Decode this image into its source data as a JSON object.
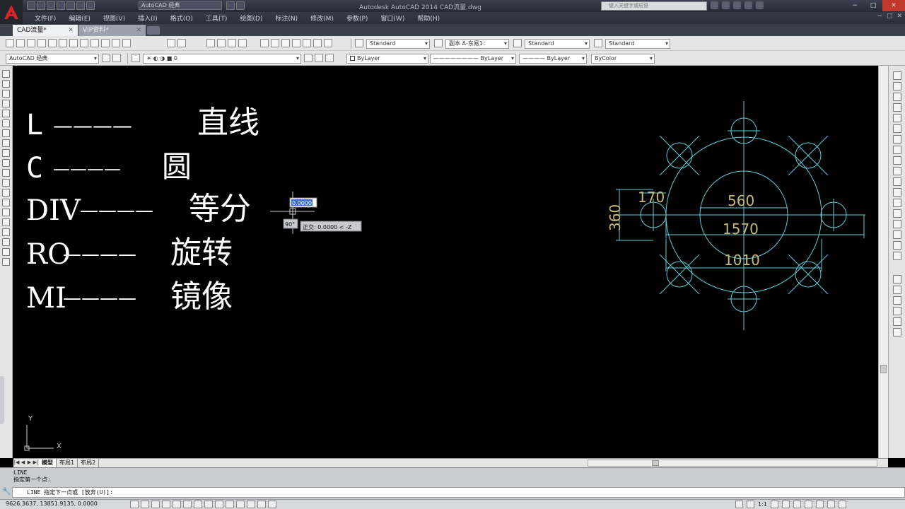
{
  "window": {
    "title": "Autodesk AutoCAD 2014    CAD流量.dwg",
    "workspace": "AutoCAD 经典",
    "search_placeholder": "键入关键字或短语",
    "controls": [
      "−",
      "□",
      "✕"
    ]
  },
  "menus": [
    "文件(F)",
    "编辑(E)",
    "视图(V)",
    "插入(I)",
    "格式(O)",
    "工具(T)",
    "绘图(D)",
    "标注(N)",
    "修改(M)",
    "参数(P)",
    "窗口(W)",
    "帮助(H)"
  ],
  "mdi_controls": [
    "−",
    "□",
    "✕"
  ],
  "tabs": [
    {
      "label": "CAD流量*",
      "close": "✕"
    },
    {
      "label": "VIP资料*",
      "close": "✕"
    }
  ],
  "styles_toolbar": {
    "text_style": "Standard",
    "dim_style": "副本 A-东易1：",
    "table_style": "Standard",
    "mleader_style": "Standard"
  },
  "layers_toolbar": {
    "workspace": "AutoCAD 经典",
    "layer": "0",
    "color": "ByLayer",
    "linetype": "ByLayer",
    "lineweight": "ByLayer",
    "plotstyle": "ByColor"
  },
  "drawing": {
    "notes": [
      {
        "cmd": "L",
        "dash": "————",
        "meaning": "直线"
      },
      {
        "cmd": "C",
        "dash": "————",
        "meaning": "圆"
      },
      {
        "cmd": "DIV",
        "dash": "————",
        "meaning": "等分"
      },
      {
        "cmd": "RO",
        "dash": "————",
        "meaning": "旋转"
      },
      {
        "cmd": "MI",
        "dash": "————",
        "meaning": "镜像"
      }
    ],
    "dims": {
      "d170": "170",
      "d360": "360",
      "d560": "560",
      "d1570": "1570",
      "d1010": "1010"
    },
    "cursor_input": "0.0000",
    "angle_tip": "90°",
    "tooltip": "正交: 0.0000 < -Z",
    "ucs_y": "Y",
    "ucs_x": "X",
    "colors": {
      "geometry": "#5fd0d6",
      "dim_text": "#c8b87a",
      "notes": "#ffffff"
    }
  },
  "layout_tabs": [
    "模型",
    "布局1",
    "布局2"
  ],
  "command": {
    "history": [
      "LINE",
      "指定第一个点:"
    ],
    "prompt": "LINE 指定下一点或 [放弃(U)]:"
  },
  "status": {
    "coords": "9626.3637,   13851.9135,  0.0000",
    "scale": "1:1"
  }
}
